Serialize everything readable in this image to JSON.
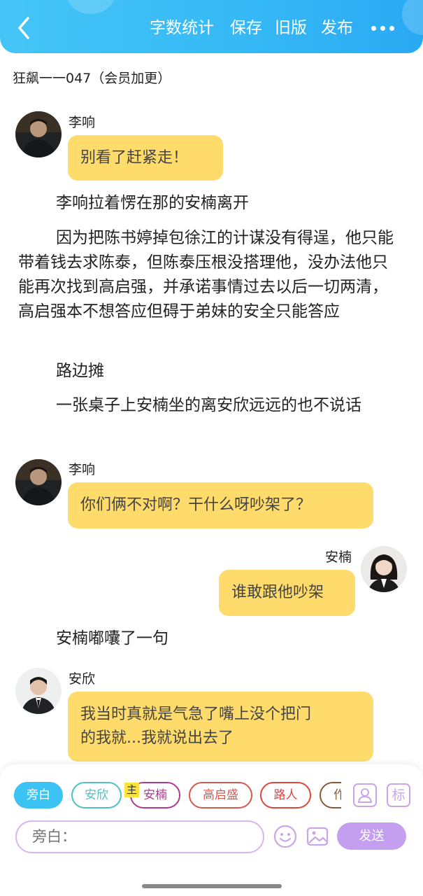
{
  "header": {
    "actions": [
      "字数统计",
      "保存",
      "旧版",
      "发布"
    ],
    "accent": "#3bbdf6"
  },
  "chapter_title": "狂飙一一047（会员加更）",
  "messages": [
    {
      "type": "dialogue",
      "side": "left",
      "speaker": "李响",
      "text": "别看了赶紧走！"
    },
    {
      "type": "narration",
      "text": "李响拉着愣在那的安楠离开"
    },
    {
      "type": "narration",
      "text": "因为把陈书婷掉包徐江的计谋没有得逞，他只能带着钱去求陈泰，但陈泰压根没搭理他，没办法他只能再次找到高启强，并承诺事情过去以后一切两清，高启强本不想答应但碍于弟妹的安全只能答应"
    },
    {
      "type": "narration",
      "text": "路边摊"
    },
    {
      "type": "narration",
      "text": "一张桌子上安楠坐的离安欣远远的也不说话"
    },
    {
      "type": "dialogue",
      "side": "left",
      "speaker": "李响",
      "text": "你们俩不对啊？干什么呀吵架了？"
    },
    {
      "type": "dialogue",
      "side": "right",
      "speaker": "安楠",
      "text": "谁敢跟他吵架"
    },
    {
      "type": "narration",
      "text": "安楠嘟囔了一句"
    },
    {
      "type": "dialogue",
      "side": "left",
      "speaker": "安欣",
      "text_lines": [
        "我当时真就是气急了嘴上没个把门",
        "的我就...我就说出去了"
      ]
    }
  ],
  "composer": {
    "roles": [
      {
        "label": "旁白",
        "active": true,
        "color": "#3cc2f3"
      },
      {
        "label": "安欣",
        "active": false,
        "color": "#4cc3c0"
      },
      {
        "label": "安楠",
        "active": false,
        "color": "#b03a8f"
      },
      {
        "label": "高启盛",
        "active": false,
        "color": "#d45a4f"
      },
      {
        "label": "路人",
        "active": false,
        "color": "#d9483d"
      },
      {
        "label": "作",
        "active": false,
        "color": "#8a5a3a"
      }
    ],
    "main_tag": "主",
    "label_icon_text": "标",
    "input_placeholder": "旁白：",
    "send_label": "发送"
  }
}
